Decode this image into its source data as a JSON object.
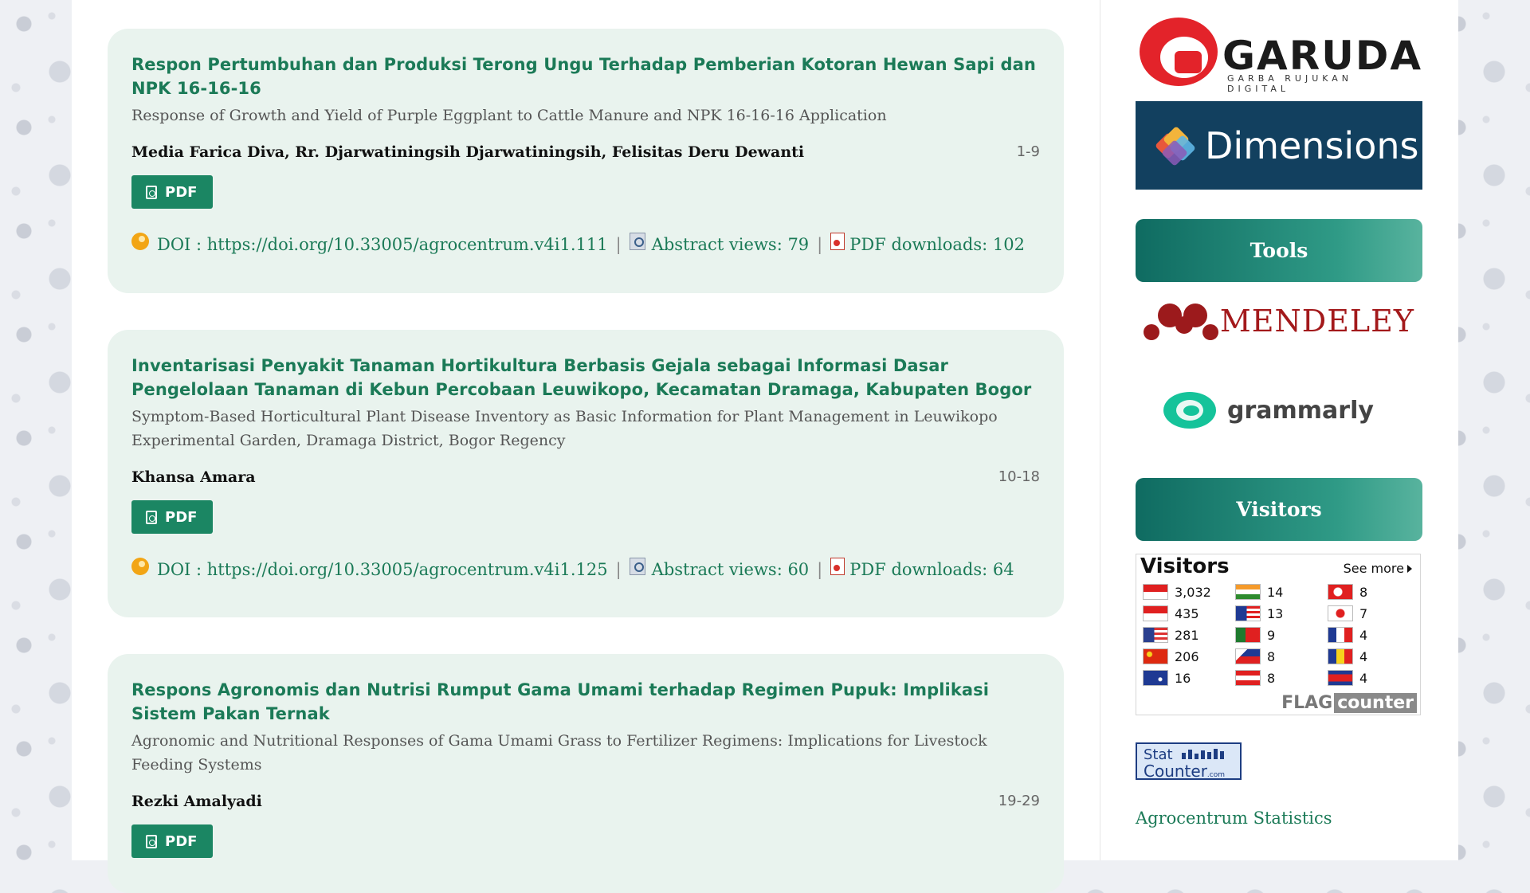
{
  "articles": [
    {
      "title": "Respon Pertumbuhan dan Produksi Terong Ungu Terhadap Pemberian Kotoran Hewan Sapi dan NPK 16-16-16",
      "subtitle": "Response of Growth and Yield of Purple Eggplant to Cattle Manure and NPK 16-16-16 Application",
      "authors": "Media Farica Diva, Rr. Djarwatiningsih Djarwatiningsih, Felisitas Deru Dewanti",
      "pages": "1-9",
      "pdf_label": "PDF",
      "doi": "DOI : https://doi.org/10.33005/agrocentrum.v4i1.111",
      "abstract_views": "Abstract views: 79",
      "pdf_downloads": "PDF downloads: 102"
    },
    {
      "title": "Inventarisasi Penyakit Tanaman Hortikultura Berbasis Gejala sebagai Informasi Dasar Pengelolaan Tanaman di Kebun Percobaan Leuwikopo, Kecamatan Dramaga, Kabupaten Bogor",
      "subtitle": "Symptom-Based Horticultural Plant Disease Inventory as Basic Information for Plant Management in Leuwikopo Experimental Garden, Dramaga District, Bogor Regency",
      "authors": "Khansa Amara",
      "pages": "10-18",
      "pdf_label": "PDF",
      "doi": "DOI : https://doi.org/10.33005/agrocentrum.v4i1.125",
      "abstract_views": "Abstract views: 60",
      "pdf_downloads": "PDF downloads: 64"
    },
    {
      "title": "Respons Agronomis dan Nutrisi Rumput Gama Umami terhadap Regimen Pupuk: Implikasi Sistem Pakan Ternak",
      "subtitle": "Agronomic and Nutritional Responses of Gama Umami Grass to Fertilizer Regimens: Implications for Livestock Feeding Systems",
      "authors": "Rezki Amalyadi",
      "pages": "19-29",
      "pdf_label": "PDF"
    }
  ],
  "separator": "|",
  "sidebar": {
    "garuda_text": "GARUDA",
    "garuda_sub": "GARBA RUJUKAN DIGITAL",
    "dimensions_text": "Dimensions",
    "tools_title": "Tools",
    "mendeley_text": "MENDELEY",
    "grammarly_text": "grammarly",
    "visitors_title": "Visitors",
    "flag_counter": {
      "title": "Visitors",
      "see_more": "See more",
      "entries": [
        {
          "count": "3,032",
          "flag": "indonesia"
        },
        {
          "count": "14",
          "flag": "india"
        },
        {
          "count": "8",
          "flag": "turkey"
        },
        {
          "count": "435",
          "flag": "singapore"
        },
        {
          "count": "13",
          "flag": "malaysia"
        },
        {
          "count": "7",
          "flag": "japan"
        },
        {
          "count": "281",
          "flag": "united-states"
        },
        {
          "count": "9",
          "flag": "portugal"
        },
        {
          "count": "4",
          "flag": "france"
        },
        {
          "count": "206",
          "flag": "china"
        },
        {
          "count": "8",
          "flag": "philippines"
        },
        {
          "count": "4",
          "flag": "romania"
        },
        {
          "count": "16",
          "flag": "australia"
        },
        {
          "count": "8",
          "flag": "austria"
        },
        {
          "count": "4",
          "flag": "cambodia"
        }
      ],
      "footer_flag": "FLAG",
      "footer_counter": "counter"
    },
    "statcounter_top": "Stat",
    "statcounter_bottom": "Counter",
    "statcounter_com": ".com",
    "statistics_link": "Agrocentrum Statistics"
  }
}
